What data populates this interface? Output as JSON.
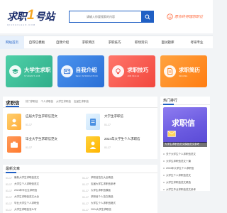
{
  "header": {
    "logo_main": "求职",
    "logo_one": "1",
    "logo_tail": "号站",
    "logo_sub": "QIUZHI1HAO.COM",
    "search_placeholder": "请输入你要搜索的内容",
    "slogan": "愿你终得理想职位"
  },
  "nav": {
    "items": [
      {
        "label": "网站首页",
        "active": true
      },
      {
        "label": "自荐信模板",
        "active": false
      },
      {
        "label": "自我介绍",
        "active": false
      },
      {
        "label": "求职简历",
        "active": false
      },
      {
        "label": "求职技巧",
        "active": false
      },
      {
        "label": "职场资讯",
        "active": false
      },
      {
        "label": "面试题库",
        "active": false
      },
      {
        "label": "考研专业",
        "active": false
      }
    ]
  },
  "banners": [
    {
      "title": "大学生求职",
      "sub": "STUDENTS JOB",
      "color": "#3fbf9a"
    },
    {
      "title": "自我介绍",
      "sub": "SELF INTRODUCTION",
      "color": "#2f7be0"
    },
    {
      "title": "求职技巧",
      "sub": "JOB SKILLS",
      "color": "#ff5a4e"
    },
    {
      "title": "求职简历",
      "sub": "RESUME",
      "color": "#ff8a1f"
    }
  ],
  "main": {
    "title": "求职信",
    "tabs": [
      "热门求职信",
      "个人求职信",
      "大学生求职信",
      "应届生求职信"
    ],
    "articles": [
      {
        "title": "应届大学生求职信范文",
        "date": "01-17"
      },
      {
        "title": "大学生求职信",
        "date": "01-17"
      },
      {
        "title": "毕业大学生求职信范文",
        "date": "01-17"
      },
      {
        "title": "2024年大学生个人求职信",
        "date": "01-17"
      }
    ]
  },
  "sidebar": {
    "title": "热门排行",
    "image_text": "求职信",
    "caption": "大学生求职信范文模板范文参考",
    "items": [
      "关于大学生个人求职信范文",
      "大学生求职信范文十篇",
      "2024年大学生个人求职信",
      "大学生个人求职信范文",
      "大学生求职信范文精选",
      "大学生毕业求职信范文参考"
    ]
  },
  "latest": {
    "title": "最新文章",
    "left": [
      {
        "date": "01-17",
        "title": "最新大学生求职信范文"
      },
      {
        "date": "01-17",
        "title": "大学生个人求职信范文"
      },
      {
        "date": "01-17",
        "title": "2024年毕业生求职信"
      },
      {
        "date": "01-17",
        "title": "大学生求职信范文大全"
      },
      {
        "date": "01-17",
        "title": "毕业大学生个人求职信"
      },
      {
        "date": "01-17",
        "title": "大学生求职信怎么写"
      }
    ],
    "right": [
      {
        "date": "01-17",
        "title": "求职信范文大全精选"
      },
      {
        "date": "01-17",
        "title": "应届大学生求职信参考"
      },
      {
        "date": "01-17",
        "title": "大学生求职信模板"
      },
      {
        "date": "01-17",
        "title": "求职信个人范文精选"
      },
      {
        "date": "01-17",
        "title": "大学生个人求职信格式"
      },
      {
        "date": "01-17",
        "title": "2024大学生求职信"
      }
    ]
  }
}
